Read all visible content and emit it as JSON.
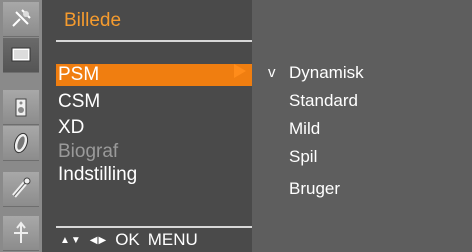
{
  "menu": {
    "title": "Billede",
    "items": [
      {
        "label": "PSM",
        "selected": true,
        "enabled": true
      },
      {
        "label": "CSM",
        "selected": false,
        "enabled": true
      },
      {
        "label": "XD",
        "selected": false,
        "enabled": true
      },
      {
        "label": "Biograf",
        "selected": false,
        "enabled": false
      },
      {
        "label": "Indstilling",
        "selected": false,
        "enabled": true
      }
    ]
  },
  "submenu": {
    "checkmark": "v",
    "options": [
      "Dynamisk",
      "Standard",
      "Mild",
      "Spil",
      "Bruger"
    ],
    "checked_index": 0
  },
  "footer": {
    "nav_updown": "▲▼",
    "nav_leftright": "◀▶",
    "ok": "OK",
    "menu": "MENU"
  },
  "sidebar": {
    "icons": [
      "satellite-icon",
      "picture-icon",
      "sound-icon",
      "time-icon",
      "settings-icon",
      "input-icon"
    ],
    "active_index": 1
  },
  "colors": {
    "accent": "#f07e10",
    "title": "#f59b2e",
    "panel": "#4a4a4a",
    "background": "#5e5e5e"
  }
}
